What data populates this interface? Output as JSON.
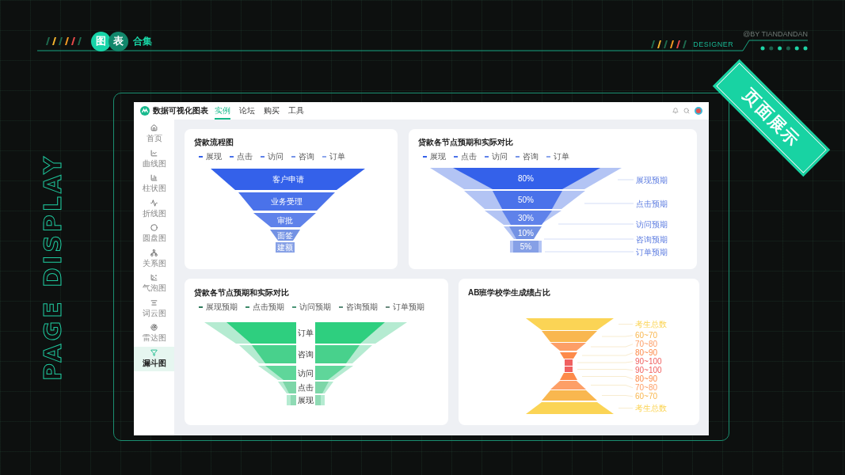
{
  "header": {
    "chips": [
      "图",
      "表"
    ],
    "suffix": "合集",
    "designer": "DESIGNER",
    "credit": "@BY TIANDANDAN"
  },
  "side_title": "PAGE DISPLAY",
  "ribbon": "页面展示",
  "app": {
    "logo": "数据可视化图表",
    "nav": [
      {
        "label": "实例",
        "selected": true
      },
      {
        "label": "论坛",
        "selected": false
      },
      {
        "label": "购买",
        "selected": false
      },
      {
        "label": "工具",
        "selected": false
      }
    ],
    "sidebar": [
      {
        "label": "首页",
        "selected": false
      },
      {
        "label": "曲线图",
        "selected": false
      },
      {
        "label": "柱状图",
        "selected": false
      },
      {
        "label": "折线图",
        "selected": false
      },
      {
        "label": "圆盘图",
        "selected": false
      },
      {
        "label": "关系图",
        "selected": false
      },
      {
        "label": "气泡图",
        "selected": false
      },
      {
        "label": "词云图",
        "selected": false
      },
      {
        "label": "雷达图",
        "selected": false
      },
      {
        "label": "漏斗图",
        "selected": true
      }
    ]
  },
  "cards": [
    {
      "kind": "funnel",
      "title": "贷款流程图",
      "legend": [
        {
          "label": "展现",
          "color": "#3461ea"
        },
        {
          "label": "点击",
          "color": "#4a72ea"
        },
        {
          "label": "访问",
          "color": "#5f82ea"
        },
        {
          "label": "咨询",
          "color": "#7694e8"
        },
        {
          "label": "订单",
          "color": "#8ca6ec"
        }
      ],
      "stages": [
        {
          "label": "客户申请",
          "color": "#3461ea"
        },
        {
          "label": "业务受理",
          "color": "#4a72ea"
        },
        {
          "label": "审批",
          "color": "#5f82ea"
        },
        {
          "label": "面签",
          "color": "#7392e4"
        },
        {
          "label": "建额",
          "color": "#86a0e6"
        }
      ]
    },
    {
      "kind": "compare",
      "title": "贷款各节点预期和实际对比",
      "legend": [
        {
          "label": "展现",
          "color": "#3461ea"
        },
        {
          "label": "点击",
          "color": "#4a72ea"
        },
        {
          "label": "访问",
          "color": "#5f82ea"
        },
        {
          "label": "咨询",
          "color": "#7694e8"
        },
        {
          "label": "订单",
          "color": "#8ca6ec"
        }
      ],
      "stages": [
        {
          "value": "80%",
          "target": "展现预期"
        },
        {
          "value": "50%",
          "target": "点击预期"
        },
        {
          "value": "30%",
          "target": "访问预期"
        },
        {
          "value": "10%",
          "target": "咨询预期"
        },
        {
          "value": "5%",
          "target": "订单预期"
        }
      ]
    },
    {
      "kind": "mirror",
      "title": "贷款各节点预期和实际对比",
      "legend": [
        {
          "label": "展现预期",
          "color": "#2f7a5c"
        },
        {
          "label": "点击预期",
          "color": "#3d8a6a"
        },
        {
          "label": "访问预期",
          "color": "#4b9677"
        },
        {
          "label": "咨询预期",
          "color": "#5a8a78"
        },
        {
          "label": "订单预期",
          "color": "#6a8a7e"
        }
      ],
      "stages": [
        {
          "label": "订单"
        },
        {
          "label": "咨询"
        },
        {
          "label": "访问"
        },
        {
          "label": "点击"
        },
        {
          "label": "展现"
        }
      ]
    },
    {
      "kind": "hourglass",
      "title": "AB班学校学生成绩占比",
      "stages": [
        {
          "label": "考生总数",
          "color": "#fbd455"
        },
        {
          "label": "60~70",
          "color": "#f9b74f"
        },
        {
          "label": "70~80",
          "color": "#fd9f67"
        },
        {
          "label": "80~90",
          "color": "#fd8a4a"
        },
        {
          "label": "90~100",
          "color": "#f06060"
        },
        {
          "label": "90~100",
          "color": "#f06060"
        },
        {
          "label": "80~90",
          "color": "#fd8a4a"
        },
        {
          "label": "70~80",
          "color": "#fd9f67"
        },
        {
          "label": "60~70",
          "color": "#f9b74f"
        },
        {
          "label": "考生总数",
          "color": "#fbd455"
        }
      ]
    }
  ]
}
